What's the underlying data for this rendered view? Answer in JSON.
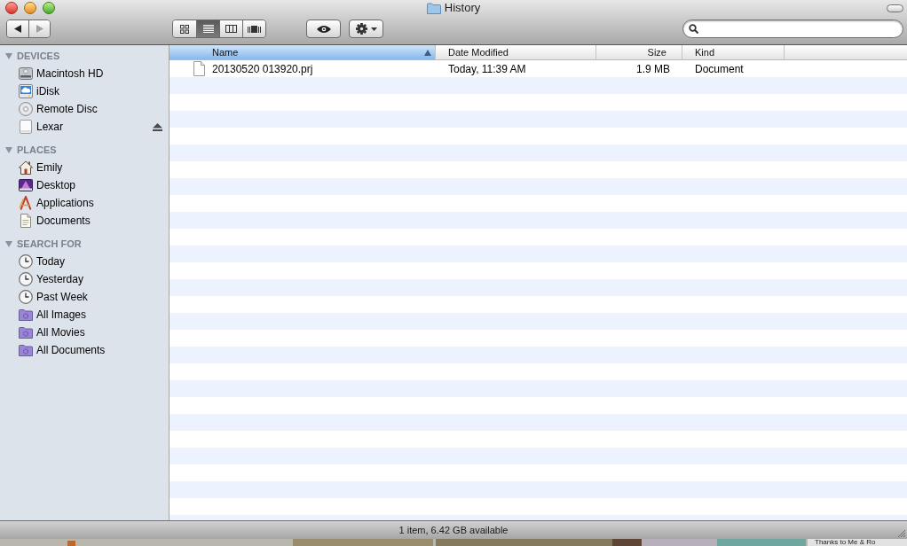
{
  "window": {
    "title": "History"
  },
  "toolbar": {
    "navigation": [
      {
        "kind": "back",
        "disabled": false
      },
      {
        "kind": "forward",
        "disabled": true
      }
    ],
    "view_buttons": [
      {
        "kind": "icons",
        "selected": false
      },
      {
        "kind": "list",
        "selected": true
      },
      {
        "kind": "columns",
        "selected": false
      },
      {
        "kind": "cover_flow",
        "selected": false
      }
    ]
  },
  "sidebar": {
    "sections": [
      {
        "title": "DEVICES",
        "expanded": true,
        "items": [
          {
            "label": "Macintosh HD",
            "kind": "hard_drive",
            "selected": false,
            "eject": false
          },
          {
            "label": "iDisk",
            "kind": "network_disk",
            "selected": false,
            "eject": false
          },
          {
            "label": "Remote Disc",
            "kind": "optical_disc",
            "selected": false,
            "eject": false
          },
          {
            "label": "Lexar",
            "kind": "removable_drive",
            "selected": false,
            "eject": true
          }
        ]
      },
      {
        "title": "PLACES",
        "expanded": true,
        "items": [
          {
            "label": "Emily",
            "kind": "home",
            "selected": false
          },
          {
            "label": "Desktop",
            "kind": "desktop",
            "selected": false
          },
          {
            "label": "Applications",
            "kind": "applications",
            "selected": false
          },
          {
            "label": "Documents",
            "kind": "documents",
            "selected": false
          }
        ]
      },
      {
        "title": "SEARCH FOR",
        "expanded": true,
        "items": [
          {
            "label": "Today",
            "kind": "clock",
            "selected": false
          },
          {
            "label": "Yesterday",
            "kind": "clock",
            "selected": false
          },
          {
            "label": "Past Week",
            "kind": "clock",
            "selected": false
          },
          {
            "label": "All Images",
            "kind": "smart_folder",
            "selected": false
          },
          {
            "label": "All Movies",
            "kind": "smart_folder",
            "selected": false
          },
          {
            "label": "All Documents",
            "kind": "smart_folder",
            "selected": false
          }
        ]
      }
    ]
  },
  "table": {
    "columns": [
      {
        "label": "Name",
        "selected": true,
        "sorted": true
      },
      {
        "label": "Date Modified",
        "selected": false,
        "sorted": false
      },
      {
        "label": "Size",
        "selected": false,
        "sorted": false
      },
      {
        "label": "Kind",
        "selected": false,
        "sorted": false
      }
    ],
    "rows": [
      {
        "cells": [
          "20130520 013920.prj",
          "Today, 11:39 AM",
          "1.9 MB",
          "Document"
        ],
        "selected": false
      }
    ]
  },
  "status_bar": {
    "text": "1 item, 6.42 GB available"
  },
  "desktop": {
    "label": "Thanks to Me & Ro"
  }
}
